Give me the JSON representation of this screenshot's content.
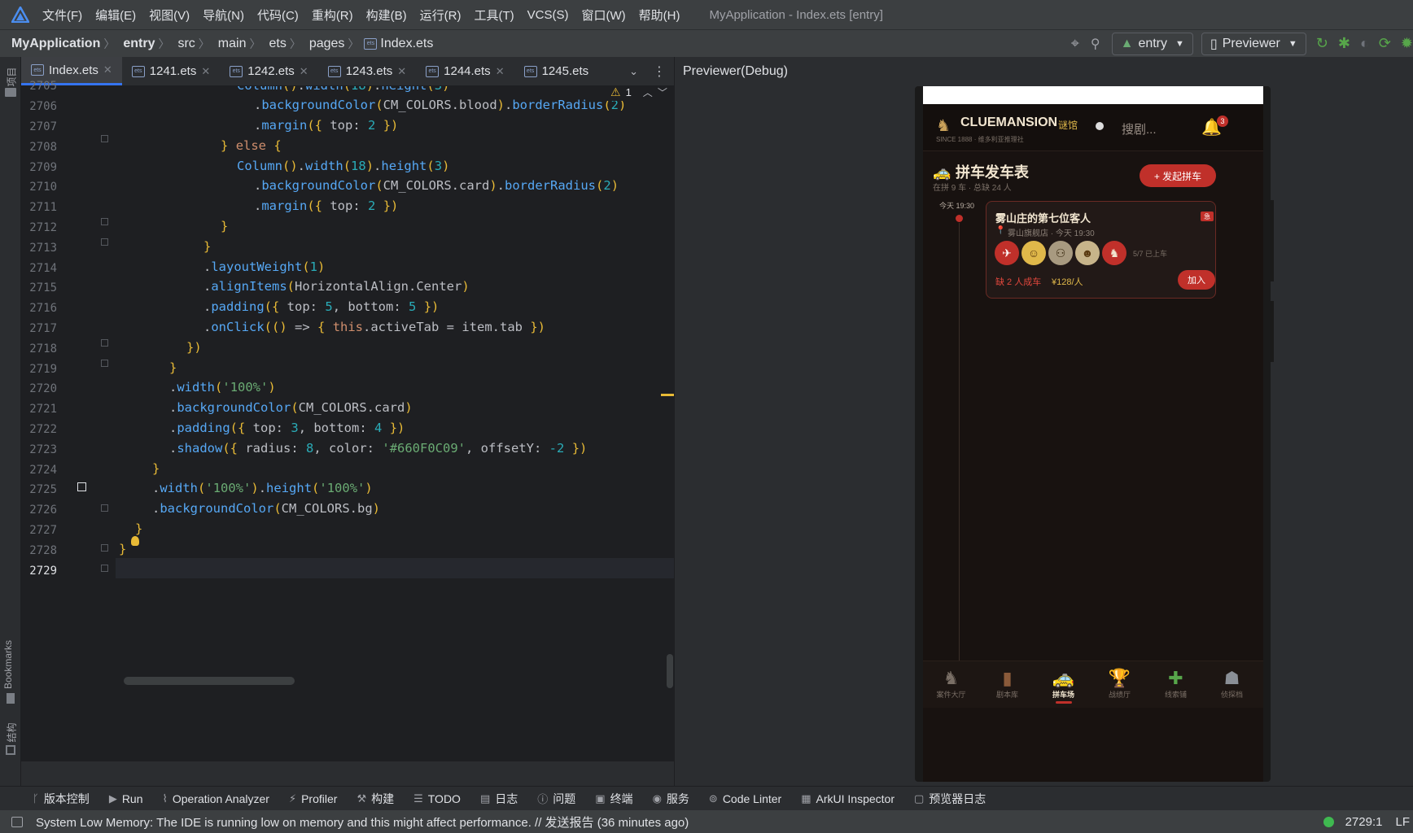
{
  "menubar": {
    "items": [
      "文件(F)",
      "编辑(E)",
      "视图(V)",
      "导航(N)",
      "代码(C)",
      "重构(R)",
      "构建(B)",
      "运行(R)",
      "工具(T)",
      "VCS(S)",
      "窗口(W)",
      "帮助(H)"
    ],
    "window_title": "MyApplication - Index.ets [entry]"
  },
  "breadcrumb": [
    "MyApplication",
    "entry",
    "src",
    "main",
    "ets",
    "pages",
    "Index.ets"
  ],
  "toolbar": {
    "module": "entry",
    "previewer": "Previewer"
  },
  "sidebar": {
    "project": "项目",
    "bookmarks": "Bookmarks",
    "structure": "结构"
  },
  "tabs": [
    "Index.ets",
    "1241.ets",
    "1242.ets",
    "1243.ets",
    "1244.ets",
    "1245.ets"
  ],
  "inspection": {
    "warnings": "1"
  },
  "editor": {
    "lines": [
      "2705",
      "2706",
      "2707",
      "2708",
      "2709",
      "2710",
      "2711",
      "2712",
      "2713",
      "2714",
      "2715",
      "2716",
      "2717",
      "2718",
      "2719",
      "2720",
      "2721",
      "2722",
      "2723",
      "2724",
      "2725",
      "2726",
      "2727",
      "2728",
      "2729"
    ],
    "current_line": "2729"
  },
  "previewer": {
    "title": "Previewer(Debug)",
    "app": {
      "brand": "CLUEMANSION",
      "brand_cn": "谜馆",
      "since": "SINCE 1888 · 维多利亚推理社",
      "search_placeholder": "搜剧...",
      "notif_count": "3",
      "section_title": "拼车发车表",
      "section_sub": "在拼 9 车 · 总缺 24 人",
      "start_button": "+ 发起拼车",
      "timeline_time": "今天 19:30",
      "card": {
        "title": "雾山庄的第七位客人",
        "badge": "急",
        "location": "雾山旗舰店 · 今天 19:30",
        "players_count": "5/7 已上车",
        "missing": "缺 2 人成车",
        "price": "¥128/人",
        "join": "加入"
      },
      "nav": [
        "案件大厅",
        "剧本库",
        "拼车场",
        "战绩厅",
        "线索铺",
        "侦探档"
      ],
      "nav_active": 2
    }
  },
  "bottom_tools": [
    "版本控制",
    "Run",
    "Operation Analyzer",
    "Profiler",
    "构建",
    "TODO",
    "日志",
    "问题",
    "终端",
    "服务",
    "Code Linter",
    "ArkUI Inspector",
    "预览器日志"
  ],
  "status": {
    "message": "System Low Memory: The IDE is running low on memory and this might affect performance. // 发送报告 (36 minutes ago)",
    "position": "2729:1",
    "extra": "LF"
  },
  "colors": {
    "accent": "#3574f0",
    "app_red": "#c0302a",
    "app_gold": "#e0b84a"
  }
}
